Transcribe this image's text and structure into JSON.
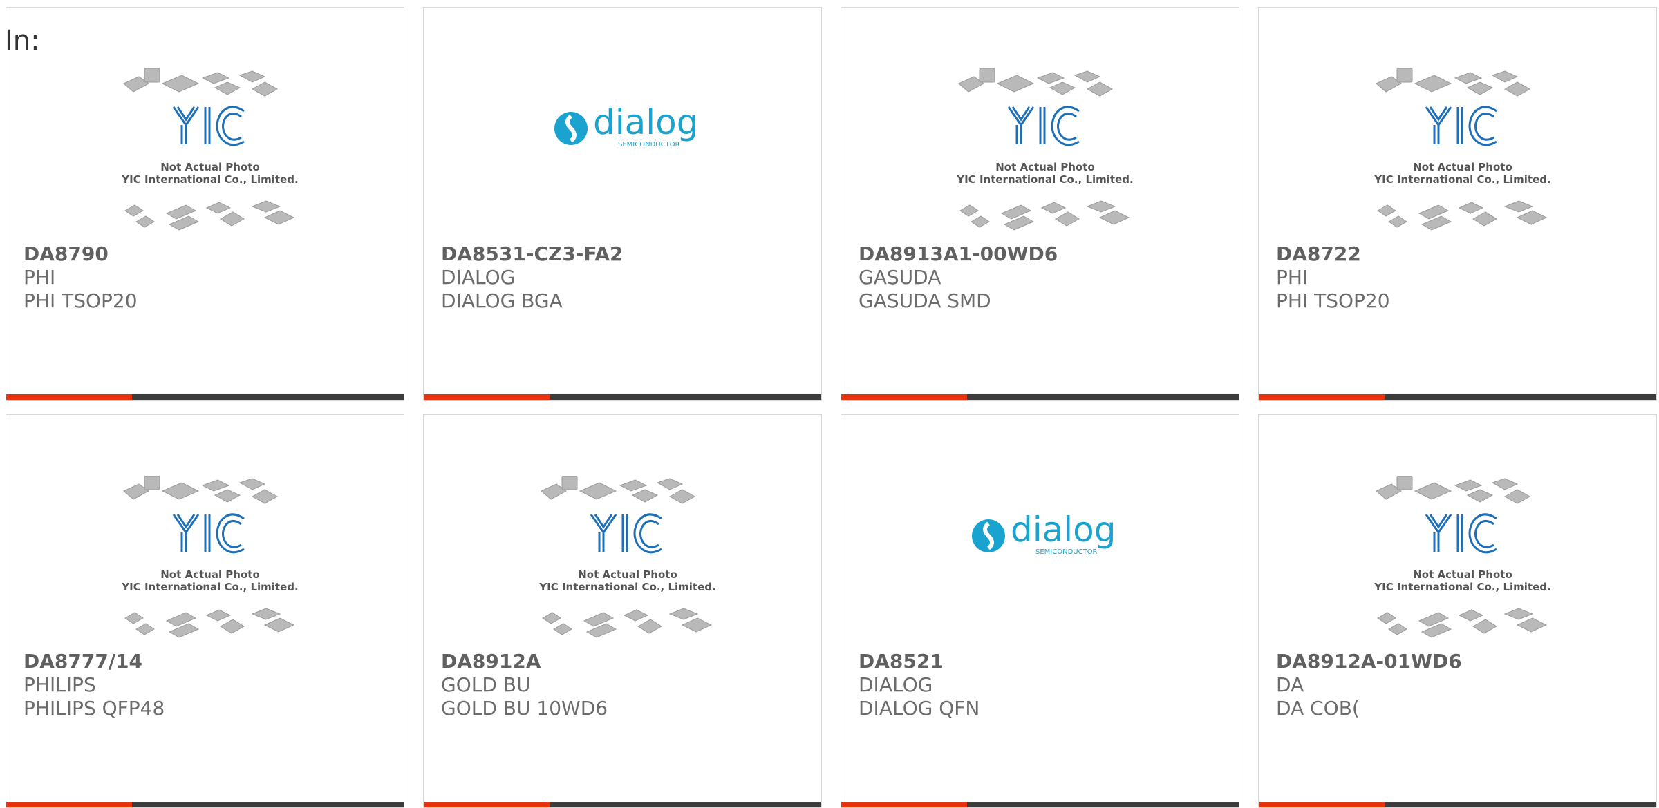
{
  "header": {
    "label": "In:"
  },
  "placeholder": {
    "line1": "Not Actual Photo",
    "line2": "YIC International Co., Limited.",
    "logo_text": "YIC"
  },
  "dialog_logo": {
    "word": "dialog",
    "sub": "SEMICONDUCTOR"
  },
  "colors": {
    "accent": "#e8340e",
    "bar": "#3c3c3c",
    "yic_blue": "#1c6fb8",
    "dialog_blue": "#1ba3d0"
  },
  "products": [
    {
      "name": "DA8790",
      "brand": "PHI",
      "package": "PHI TSOP20",
      "image": "yic-placeholder"
    },
    {
      "name": "DA8531-CZ3-FA2",
      "brand": "DIALOG",
      "package": "DIALOG BGA",
      "image": "dialog-logo"
    },
    {
      "name": "DA8913A1-00WD6",
      "brand": "GASUDA",
      "package": "GASUDA SMD",
      "image": "yic-placeholder"
    },
    {
      "name": "DA8722",
      "brand": "PHI",
      "package": "PHI TSOP20",
      "image": "yic-placeholder"
    },
    {
      "name": "DA8777/14",
      "brand": "PHILIPS",
      "package": "PHILIPS QFP48",
      "image": "yic-placeholder"
    },
    {
      "name": "DA8912A",
      "brand": "GOLD BU",
      "package": "GOLD BU 10WD6",
      "image": "yic-placeholder"
    },
    {
      "name": "DA8521",
      "brand": "DIALOG",
      "package": "DIALOG QFN",
      "image": "dialog-logo"
    },
    {
      "name": "DA8912A-01WD6",
      "brand": "DA",
      "package": "DA COB(",
      "image": "yic-placeholder"
    }
  ]
}
